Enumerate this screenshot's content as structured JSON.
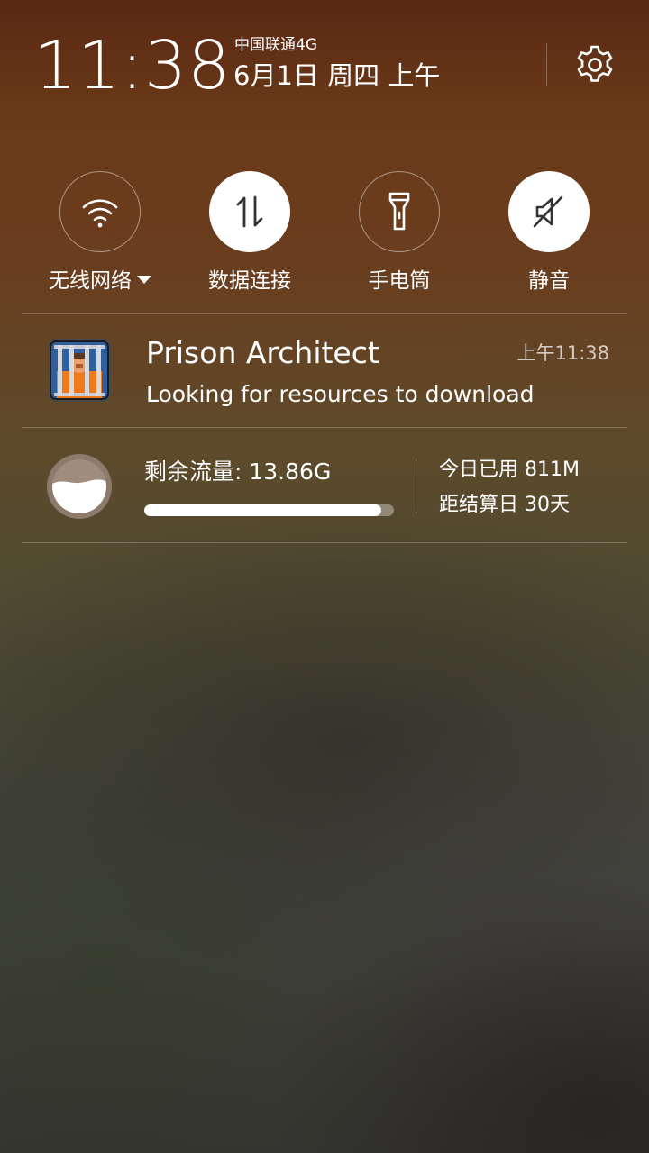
{
  "header": {
    "time": "11:38",
    "carrier": "中国联通4G",
    "date": "6月1日 周四 上午"
  },
  "quick_toggles": [
    {
      "label": "无线网络",
      "icon": "wifi-icon",
      "state": "off",
      "has_dropdown": true
    },
    {
      "label": "数据连接",
      "icon": "mobile-data-arrows-icon",
      "state": "on"
    },
    {
      "label": "手电筒",
      "icon": "flashlight-icon",
      "state": "off"
    },
    {
      "label": "静音",
      "icon": "mute-speaker-icon",
      "state": "on"
    }
  ],
  "notification": {
    "app_icon": "prison-architect-app-icon",
    "title": "Prison Architect",
    "time": "上午11:38",
    "body": "Looking for resources to download"
  },
  "data_usage": {
    "icon": "data-usage-icon",
    "remaining_label": "剩余流量: 13.86G",
    "remaining_fraction": 0.95,
    "today_used": "今日已用 811M",
    "billing_day": "距结算日 30天"
  },
  "colors": {
    "text": "#ffffff",
    "toggle_on_bg": "#ffffff",
    "toggle_on_icon": "#333333"
  }
}
